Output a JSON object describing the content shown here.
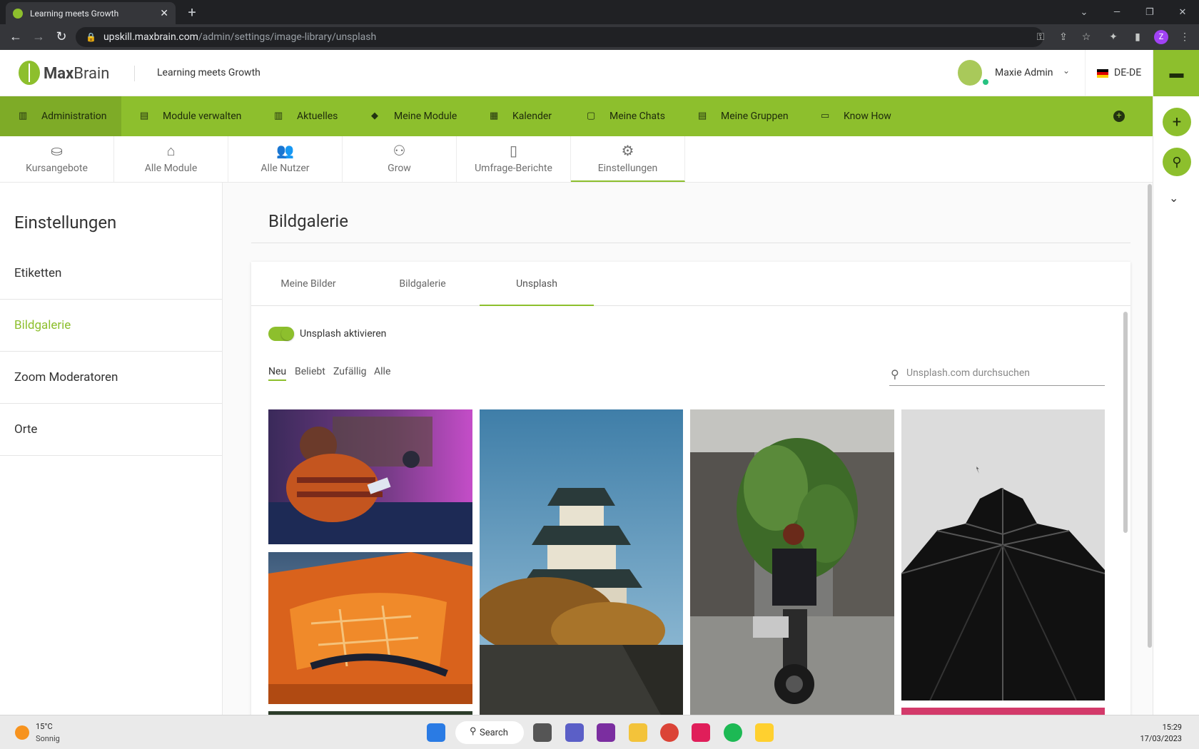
{
  "browser": {
    "tab_title": "Learning meets Growth",
    "url_host": "upskill.maxbrain.com",
    "url_path": "/admin/settings/image-library/unsplash",
    "profile_initial": "Z"
  },
  "header": {
    "logo_bold": "Max",
    "logo_light": "Brain",
    "tagline": "Learning meets Growth",
    "username": "Maxie Admin",
    "language": "DE-DE"
  },
  "main_nav": [
    {
      "label": "Administration",
      "icon": "admin-icon"
    },
    {
      "label": "Module verwalten",
      "icon": "folder-icon"
    },
    {
      "label": "Aktuelles",
      "icon": "news-icon"
    },
    {
      "label": "Meine Module",
      "icon": "graduation-cap-icon"
    },
    {
      "label": "Kalender",
      "icon": "calendar-icon"
    },
    {
      "label": "Meine Chats",
      "icon": "chat-icon"
    },
    {
      "label": "Meine Gruppen",
      "icon": "group-folder-icon"
    },
    {
      "label": "Know How",
      "icon": "book-icon"
    }
  ],
  "sub_nav": [
    {
      "label": "Kursangebote",
      "icon": "hand-book-icon"
    },
    {
      "label": "Alle Module",
      "icon": "institution-icon"
    },
    {
      "label": "Alle Nutzer",
      "icon": "users-icon"
    },
    {
      "label": "Grow",
      "icon": "group-icon"
    },
    {
      "label": "Umfrage-Berichte",
      "icon": "report-icon"
    },
    {
      "label": "Einstellungen",
      "icon": "gears-icon"
    }
  ],
  "sidebar": {
    "title": "Einstellungen",
    "items": [
      "Etiketten",
      "Bildgalerie",
      "Zoom Moderatoren",
      "Orte"
    ],
    "active_index": 1
  },
  "page": {
    "title": "Bildgalerie",
    "tabs": [
      "Meine Bilder",
      "Bildgalerie",
      "Unsplash"
    ],
    "active_tab": 2,
    "toggle_label": "Unsplash aktivieren",
    "filters": [
      "Neu",
      "Beliebt",
      "Zufällig",
      "Alle"
    ],
    "active_filter": 0,
    "search_placeholder": "Unsplash.com durchsuchen"
  },
  "images": [
    {
      "name": "woman-gaming-photo"
    },
    {
      "name": "castle-photo"
    },
    {
      "name": "motorbike-plants-photo"
    },
    {
      "name": "black-sculpture-photo"
    },
    {
      "name": "orange-pavilion-photo"
    }
  ],
  "taskbar": {
    "temperature": "15°C",
    "weather": "Sonnig",
    "search_label": "Search",
    "time": "15:29",
    "date": "17/03/2023"
  },
  "colors": {
    "brand_green": "#8dbf2d",
    "nav_active": "#7eab27"
  }
}
